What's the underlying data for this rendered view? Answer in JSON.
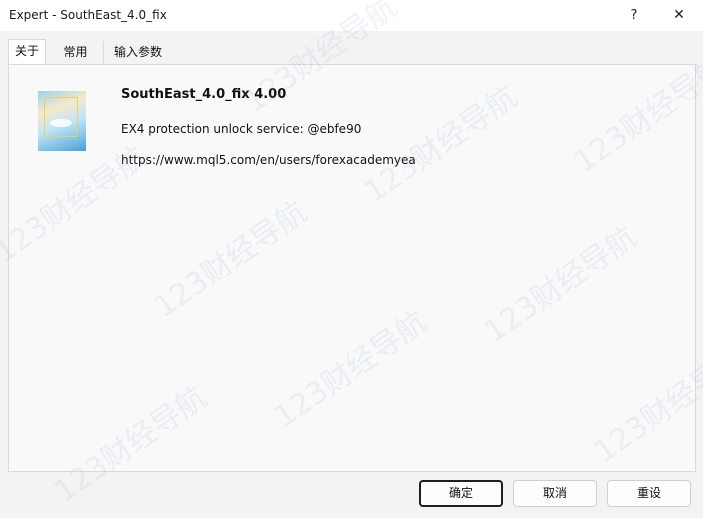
{
  "window": {
    "title": "Expert - SouthEast_4.0_fix",
    "help_label": "?",
    "close_label": "✕"
  },
  "tabs": [
    {
      "label": "关于",
      "active": true
    },
    {
      "label": "常用",
      "active": false
    },
    {
      "label": "输入参数",
      "active": false
    }
  ],
  "about": {
    "name": "SouthEast_4.0_fix 4.00",
    "description": "EX4 protection unlock service: @ebfe90",
    "link": "https://www.mql5.com/en/users/forexacademyea"
  },
  "buttons": {
    "ok": "确定",
    "cancel": "取消",
    "reset": "重设"
  },
  "watermark_text": "123财经导航"
}
